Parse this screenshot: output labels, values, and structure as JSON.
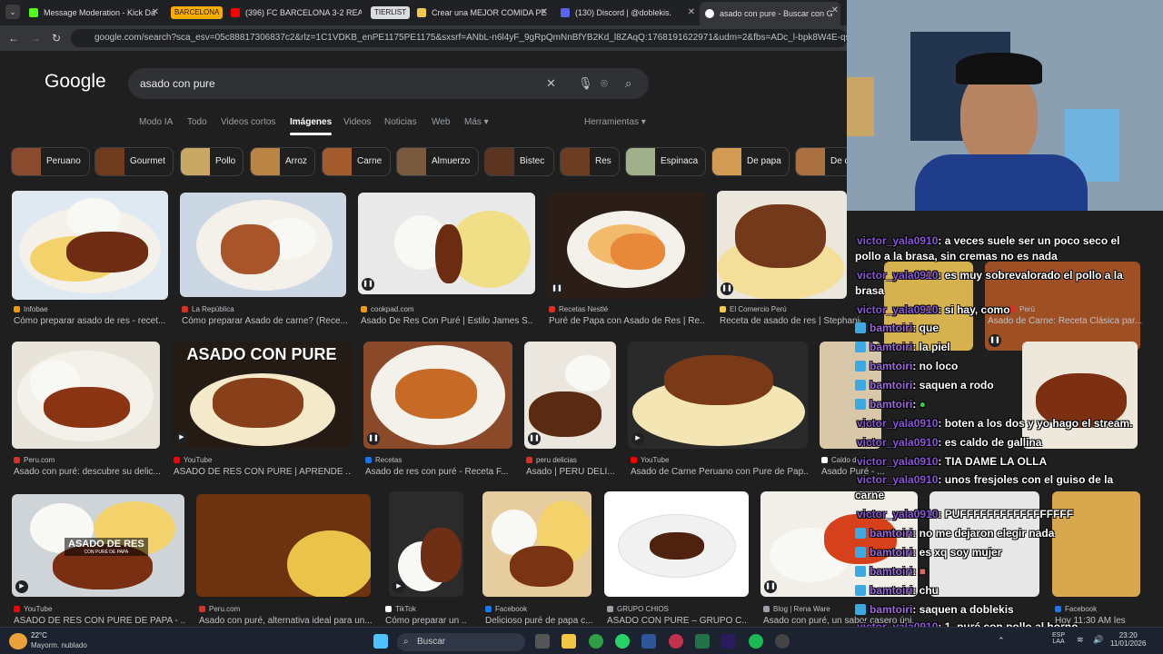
{
  "browser": {
    "tabs": [
      {
        "title": "Message Moderation - Kick Da",
        "color": "#53fc18"
      },
      {
        "title": "(396) FC BARCELONA 3-2 REAL",
        "color": "#ff0000"
      },
      {
        "title": "Crear una MEJOR COMIDA PE",
        "color": "#f2c94c"
      },
      {
        "title": "(130) Discord | @doblekis.",
        "color": "#5865f2"
      },
      {
        "title": "asado con pure - Buscar con G",
        "color": "#ffffff"
      }
    ],
    "groups": [
      "BARCELONA",
      "TIERLIST"
    ],
    "url": "google.com/search?sca_esv=05c88817306837c2&rlz=1C1VDKB_enPE1175PE1175&sxsrf=ANbL-n6l4yF_9gRpQmNnBfYB2Kd_l8ZAqQ:1768191622971&udm=2&fbs=ADc_l-bpk8W4E-qsVlOvbGJcDwpnC",
    "url_host": "google.com"
  },
  "google": {
    "logo": "Google",
    "query": "asado con pure",
    "tabs": [
      "Modo IA",
      "Todo",
      "Videos cortos",
      "Imágenes",
      "Videos",
      "Noticias",
      "Web",
      "Más"
    ],
    "tools": "Herramientas",
    "chips": [
      "Peruano",
      "Gourmet",
      "Pollo",
      "Arroz",
      "Carne",
      "Almuerzo",
      "Bistec",
      "Res",
      "Espinaca",
      "De papa",
      "De c"
    ]
  },
  "results": [
    {
      "source": "Infobae",
      "title": "Cómo preparar asado de res - recet...",
      "color": "#f29900"
    },
    {
      "source": "La República",
      "title": "Cómo preparar Asado de carne? (Rece...",
      "color": "#d93025"
    },
    {
      "source": "cookpad.com",
      "title": "Asado De Res Con Puré | Estilo James S...",
      "color": "#f29900"
    },
    {
      "source": "Recetas Nestlé",
      "title": "Puré de Papa con Asado de Res | Re...",
      "color": "#d93025"
    },
    {
      "source": "El Comercio Perú",
      "title": "Receta de asado de res | Stephanie...",
      "color": "#f2c94c"
    },
    {
      "source": "Perú",
      "title": "Asado de Carne: Receta Clásica par...",
      "color": "#d93025"
    },
    {
      "source": "Peru.com",
      "title": "Asado con puré: descubre su delic...",
      "color": "#d93025"
    },
    {
      "source": "YouTube",
      "title": "ASADO DE RES CON PURE | APRENDE ...",
      "color": "#ff0000"
    },
    {
      "source": "Recetas",
      "title": "Asado de res con puré - Receta F...",
      "color": "#1a73e8"
    },
    {
      "source": "peru delicias",
      "title": "Asado | PERU DELI...",
      "color": "#d93025"
    },
    {
      "source": "YouTube",
      "title": "Asado de Carne Peruano con Pure de Pap...",
      "color": "#ff0000"
    },
    {
      "source": "Caldo de",
      "title": "Asado Puré - ...",
      "color": "#ffffff"
    },
    {
      "source": "YouTube",
      "title": "ASADO DE RES CON PURÉ DE PAPA - ...",
      "color": "#ff0000"
    },
    {
      "source": "Peru.com",
      "title": "Asado con puré, alternativa ideal para un...",
      "color": "#d93025"
    },
    {
      "source": "TikTok",
      "title": "Cómo preparar un ...",
      "color": "#ffffff"
    },
    {
      "source": "Facebook",
      "title": "Delicioso puré de papa c...",
      "color": "#1877f2"
    },
    {
      "source": "GRUPO CHIOS",
      "title": "ASADO CON PURÉ – GRUPO C...",
      "color": "#9aa0a6"
    },
    {
      "source": "Blog | Rena Ware",
      "title": "Asado con puré, un sabor casero úni...",
      "color": "#9aa0a6"
    },
    {
      "source": "Facebook",
      "title": "Hoy 11:30 AM les",
      "color": "#1877f2"
    }
  ],
  "overlay_text": {
    "banner": "ASADO CON PURE",
    "plate_title": "ASADO DE RES",
    "plate_sub": "CON PURÉ DE PAPA"
  },
  "chat": [
    {
      "user": "victor_yala0910",
      "msg": ": a veces suele ser un poco seco el"
    },
    {
      "user": "",
      "msg": "pollo a la brasa, sin cremas no es nada"
    },
    {
      "user": "victor_yala0910",
      "msg": ": es muy sobrevalorado el pollo a la"
    },
    {
      "user": "",
      "msg": "brasa"
    },
    {
      "user": "victor_yala0910",
      "msg": ": si hay, como"
    },
    {
      "user": "bamtoiri",
      "msg": ": que",
      "badge": true
    },
    {
      "user": "bamtoiri",
      "msg": ": la piel",
      "badge": true
    },
    {
      "user": "bamtoiri",
      "msg": ": no loco",
      "badge": true
    },
    {
      "user": "bamtoiri",
      "msg": ": saquen a rodo",
      "badge": true
    },
    {
      "user": "bamtoiri",
      "msg": ":",
      "badge": true
    },
    {
      "user": "victor_yala0910",
      "msg": ": boten a los dos y yo hago el stream."
    },
    {
      "user": "victor_yala0910",
      "msg": ": es caldo de gallina"
    },
    {
      "user": "victor_yala0910",
      "msg": ": TIA DAME LA OLLA"
    },
    {
      "user": "victor_yala0910",
      "msg": ": unos fresjoles con el guiso de la"
    },
    {
      "user": "",
      "msg": "carne"
    },
    {
      "user": "victor_yala0910",
      "msg": ": PUFFFFFFFFFFFFFFFFF"
    },
    {
      "user": "bamtoiri",
      "msg": ": no me dejaron elegir nada",
      "badge": true
    },
    {
      "user": "bamtoiri",
      "msg": ": es xq soy mujer",
      "badge": true
    },
    {
      "user": "bamtoiri",
      "msg": ":",
      "badge": true
    },
    {
      "user": "bamtoiri",
      "msg": ": chu",
      "badge": true
    },
    {
      "user": "bamtoiri",
      "msg": ": saquen a doblekis",
      "badge": true
    },
    {
      "user": "victor_yala0910",
      "msg": ": 1. puré con pollo al horno"
    }
  ],
  "taskbar": {
    "weather_temp": "22°C",
    "weather_desc": "Mayorm. nublado",
    "search": "Buscar",
    "lang": "ESP",
    "lang2": "LAA",
    "time": "23:20",
    "date": "11/01/2026"
  }
}
